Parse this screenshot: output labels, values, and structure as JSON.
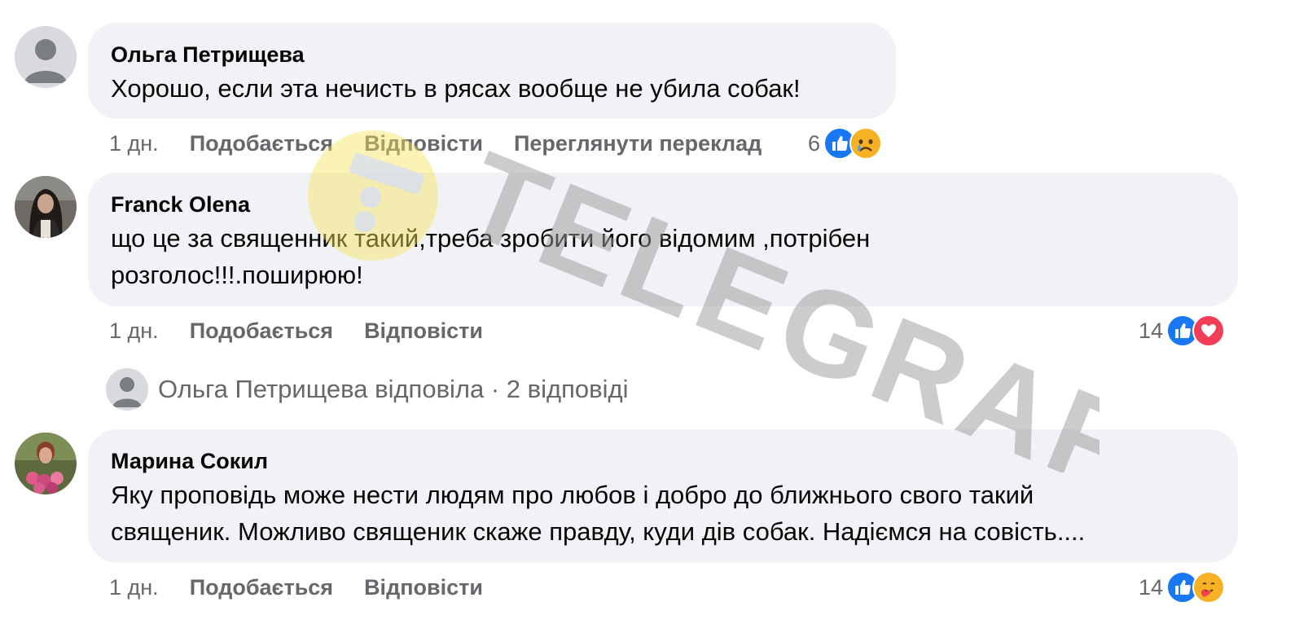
{
  "comments": [
    {
      "author": "Ольга Петрищева",
      "text": "Хорошо, если эта нечисть в рясах вообще не убила собак!",
      "time": "1 дн.",
      "like_label": "Подобається",
      "reply_label": "Відповісти",
      "translate_label": "Переглянути переклад",
      "reaction_count": "6",
      "reactions": [
        "like-icon",
        "sad-icon"
      ]
    },
    {
      "author": "Franck Olena",
      "text_line1": "що це за священник такий,треба зробити його відомим ,потрібен",
      "text_line2": "розголос!!!.поширюю!",
      "time": "1 дн.",
      "like_label": "Подобається",
      "reply_label": "Відповісти",
      "reaction_count": "14",
      "reactions": [
        "like-icon",
        "love-icon"
      ]
    },
    {
      "author": "Марина Сокил",
      "text_line1": "Яку проповідь може нести людям про любов і добро до ближнього свого такий",
      "text_line2": "священик. Можливо священик скаже правду, куди дів собак. Надіємся на совість....",
      "time": "1 дн.",
      "like_label": "Подобається",
      "reply_label": "Відповісти",
      "reaction_count": "14",
      "reactions": [
        "like-icon",
        "care-icon"
      ]
    }
  ],
  "replies_summary": "Ольга Петрищева відповіла · 2 відповіді",
  "watermark": "TELEGRAF",
  "colors": {
    "bubble": "#f0f2f5",
    "meta_text": "#65676b",
    "like": "#1877f2",
    "love": "#f33e58",
    "emoji": "#f7b125",
    "watermark_gray": "#9a9a9a",
    "watermark_yellow": "#f6e35a"
  }
}
